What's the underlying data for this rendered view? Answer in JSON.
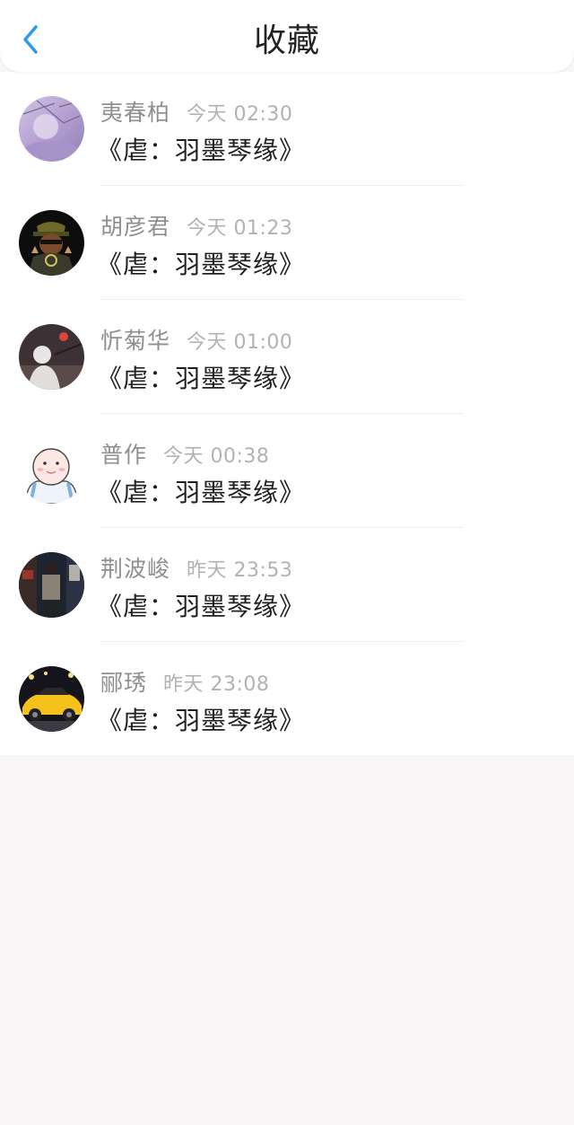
{
  "header": {
    "title": "收藏",
    "back_icon": "chevron-left-icon",
    "accent_color": "#2e9ae8"
  },
  "favorites": [
    {
      "name": "夷春柏",
      "time": "今天 02:30",
      "title": "《虐：羽墨琴缘》"
    },
    {
      "name": "胡彦君",
      "time": "今天 01:23",
      "title": "《虐：羽墨琴缘》"
    },
    {
      "name": "忻菊华",
      "time": "今天 01:00",
      "title": "《虐：羽墨琴缘》"
    },
    {
      "name": "普作",
      "time": "今天 00:38",
      "title": "《虐：羽墨琴缘》"
    },
    {
      "name": "荆波峻",
      "time": "昨天 23:53",
      "title": "《虐：羽墨琴缘》"
    },
    {
      "name": "郦琇",
      "time": "昨天 23:08",
      "title": "《虐：羽墨琴缘》"
    }
  ]
}
